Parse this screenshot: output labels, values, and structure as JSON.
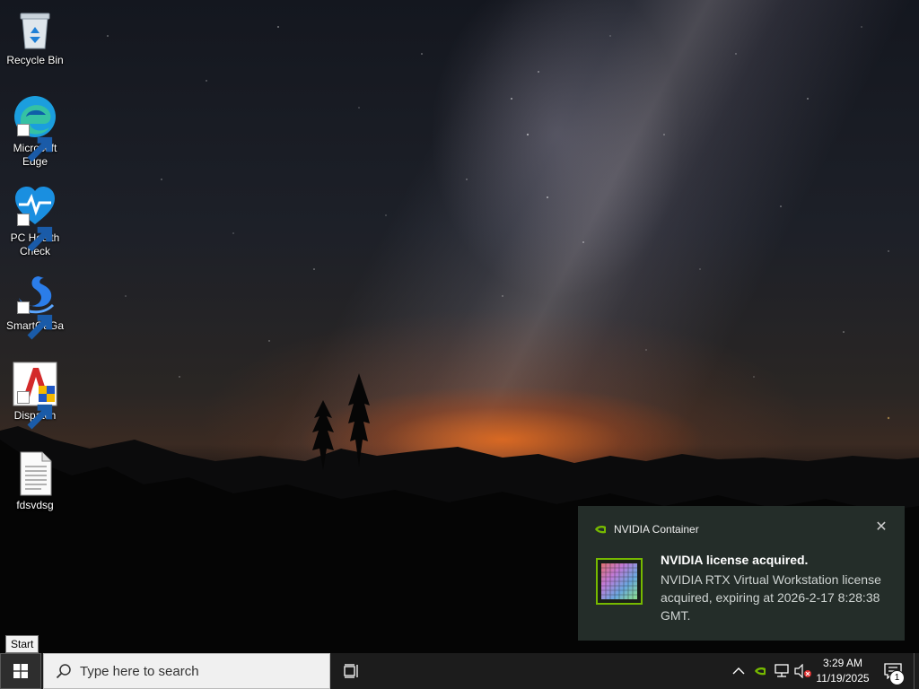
{
  "desktop_icons": [
    {
      "label": "Recycle Bin",
      "icon": "recycle-bin-icon"
    },
    {
      "label": "Microsoft Edge",
      "icon": "edge-icon"
    },
    {
      "label": "PC Health Check",
      "icon": "pc-health-check-icon"
    },
    {
      "label": "SmartGaGa",
      "icon": "smartgaga-icon"
    },
    {
      "label": "Dispatch",
      "icon": "dispatch-icon"
    },
    {
      "label": "fdsvdsg",
      "icon": "text-file-icon"
    }
  ],
  "tooltip": {
    "text": "Start"
  },
  "notification": {
    "app_name": "NVIDIA Container",
    "title": "NVIDIA license acquired.",
    "body": "NVIDIA RTX Virtual Workstation license acquired, expiring at 2026-2-17 8:28:38 GMT.",
    "close_icon": "close-icon",
    "accent": "#76b900"
  },
  "taskbar": {
    "search_placeholder": "Type here to search",
    "clock_time": "3:29 AM",
    "clock_date": "11/19/2025",
    "notification_count": "1",
    "tray_icons": [
      "chevron-up-icon",
      "nvidia-icon",
      "network-icon",
      "volume-muted-icon"
    ]
  }
}
